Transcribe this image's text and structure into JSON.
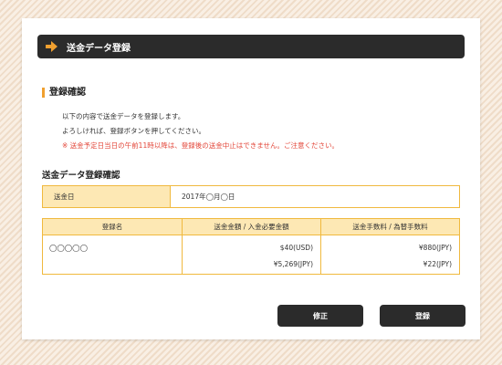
{
  "header": {
    "title": "送金データ登録",
    "icon": "arrow-right-icon",
    "accent": "#f0a030"
  },
  "confirm": {
    "title": "登録確認",
    "messages": [
      "以下の内容で送金データを登録します。",
      "よろしければ、登録ボタンを押してください。"
    ],
    "notice": "※ 送金予定日当日の午前11時以降は、登録後の送金中止はできません。ご注意ください。"
  },
  "registration": {
    "title": "送金データ登録確認",
    "date_label": "送金日",
    "date_value": "2017年◯月◯日"
  },
  "fee_table": {
    "headers": [
      "登録名",
      "送金金額 / 入金必要金額",
      "送金手数料 / 為替手数料"
    ],
    "row": {
      "name": "◯◯◯◯◯",
      "send_amount": "$40(USD)",
      "required_amount": "¥5,269(JPY)",
      "send_fee": "¥880(JPY)",
      "exchange_fee": "¥22(JPY)"
    }
  },
  "buttons": {
    "edit": "修正",
    "submit": "登録"
  }
}
